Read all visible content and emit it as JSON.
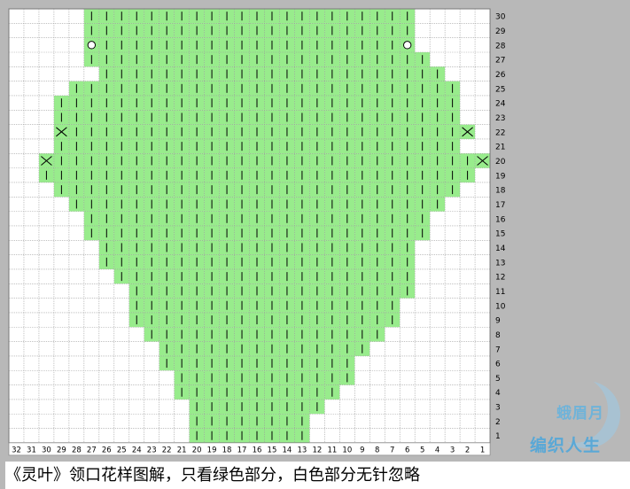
{
  "chart": {
    "columns": 32,
    "rows": 30,
    "row_labels": [
      "1",
      "2",
      "3",
      "4",
      "5",
      "6",
      "7",
      "8",
      "9",
      "10",
      "11",
      "12",
      "13",
      "14",
      "15",
      "16",
      "17",
      "18",
      "19",
      "20",
      "21",
      "22",
      "23",
      "24",
      "25",
      "26",
      "27",
      "28",
      "29",
      "30"
    ],
    "column_labels": [
      "1",
      "2",
      "3",
      "4",
      "5",
      "6",
      "7",
      "8",
      "9",
      "10",
      "11",
      "12",
      "13",
      "14",
      "15",
      "16",
      "17",
      "18",
      "19",
      "20",
      "21",
      "22",
      "23",
      "24",
      "25",
      "26",
      "27",
      "28",
      "29",
      "30",
      "31",
      "32"
    ],
    "colors": {
      "stitch_area": "#98ec8c",
      "background": "#ffffff",
      "grid": "#9a9a9a",
      "grid_strong": "#7a7a7a",
      "symbol": "#000000",
      "margin": "#b8b8b8"
    },
    "symbol_names": {
      "|": "knit",
      "o": "yarn-over",
      "v": "center-double-decrease",
      "x": "cross",
      "/": "right-decrease",
      "\\": "left-decrease",
      "loop": "twist",
      "-": "purl"
    },
    "grid_rows": [
      ".....||||||||||||||||||||||.....",
      ".....||||||||||||||||||||||.....",
      ".....o||||||||||||||||||||o.....",
      ".....|||||||||||||||||||||||....",
      "......|||||||||||||||||||||||...",
      "....||||||||||||||||||||||||||..",
      "...|||||||||||||||||||||||||||..",
      "...|||||||||||||||||||||||||||..",
      "...x||||||||||||||||||||||||||x.",
      "...|||||||||||||||||||||||||||..",
      "..x||||||||||||||||||||||||||||x",
      "..|||||||||||||||||||||||||||||.",
      "...|||||||||||||||||||||||||||..",
      "....|||||||||||||||||||||||||...",
      ".....|||||||||||||||||||||||....",
      ".....|||||||||||||||||||||||....",
      "......|||||||||||||||||||||.....",
      "......|||||||||||||||||||||.....",
      ".......||||||||||||||||||||.....",
      "........|||||||||||||||||||.....",
      "........||||||||||||||||||......",
      "........||||||||||||||||||......",
      ".........||||||||||||||||.......",
      "..........||||||||||||||........",
      "..........|||||||||||||.........",
      "...........||||||||||||.........",
      "...........|||||||||||..........",
      "............|||||||||...........",
      "............||||||||............",
      "............||||||||............"
    ],
    "caption": "《灵叶》领口花样图解，只看绿色部分，白色部分无针忽略",
    "watermark_line1": "蛾眉月",
    "watermark_line2": "编织人生"
  }
}
